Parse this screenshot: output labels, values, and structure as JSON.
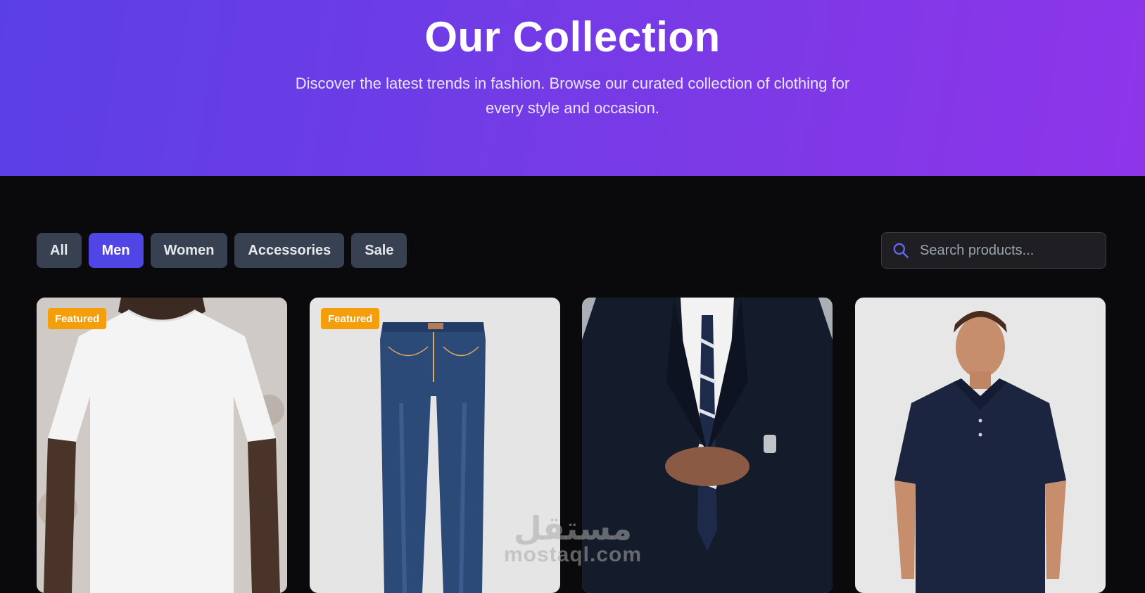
{
  "hero": {
    "title": "Our Collection",
    "subtitle": "Discover the latest trends in fashion. Browse our curated collection of clothing for every style and occasion."
  },
  "filters": [
    "All",
    "Men",
    "Women",
    "Accessories",
    "Sale"
  ],
  "active_filter": "Men",
  "search": {
    "placeholder": "Search products...",
    "icon": "search-icon"
  },
  "products": [
    {
      "badge": "Featured",
      "image": "white-tshirt"
    },
    {
      "badge": "Featured",
      "image": "blue-jeans"
    },
    {
      "badge": "",
      "image": "navy-suit"
    },
    {
      "badge": "",
      "image": "navy-polo"
    }
  ],
  "watermark": {
    "arabic": "مستقل",
    "latin": "mostaql.com"
  },
  "colors": {
    "hero_start": "#5b3fe6",
    "hero_end": "#8e35ea",
    "active_chip": "#4f46e5",
    "chip": "#374151",
    "badge": "#f59e0b",
    "page_bg": "#0a0a0c"
  }
}
